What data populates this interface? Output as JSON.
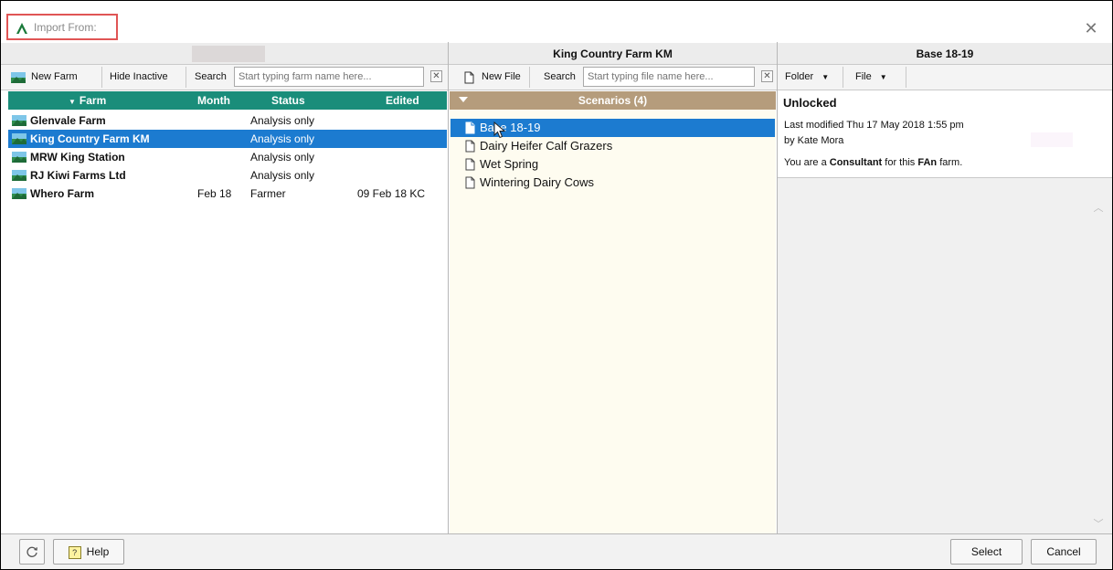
{
  "window": {
    "title": "Import From:"
  },
  "farm_panel": {
    "toolbar": {
      "new_farm": "New Farm",
      "hide_inactive": "Hide Inactive",
      "search_label": "Search",
      "search_placeholder": "Start typing farm name here..."
    },
    "columns": {
      "farm": "Farm",
      "month": "Month",
      "status": "Status",
      "edited": "Edited"
    },
    "rows": [
      {
        "name": "Glenvale Farm",
        "month": "",
        "status": "Analysis only",
        "edited": "",
        "selected": false
      },
      {
        "name": "King Country Farm KM",
        "month": "",
        "status": "Analysis only",
        "edited": "",
        "selected": true
      },
      {
        "name": "MRW King Station",
        "month": "",
        "status": "Analysis only",
        "edited": "",
        "selected": false
      },
      {
        "name": "RJ Kiwi Farms Ltd",
        "month": "",
        "status": "Analysis only",
        "edited": "",
        "selected": false
      },
      {
        "name": "Whero Farm",
        "month": "Feb 18",
        "status": "Farmer",
        "edited": "09 Feb 18 KC",
        "selected": false
      }
    ]
  },
  "file_panel": {
    "heading": "King Country Farm KM",
    "toolbar": {
      "new_file": "New File",
      "search_label": "Search",
      "search_placeholder": "Start typing file name here..."
    },
    "scenarios_title": "Scenarios (4)",
    "scenarios": [
      {
        "label": "Base 18-19",
        "selected": true
      },
      {
        "label": "Dairy Heifer Calf Grazers",
        "selected": false
      },
      {
        "label": "Wet Spring",
        "selected": false
      },
      {
        "label": "Wintering Dairy Cows",
        "selected": false
      }
    ]
  },
  "details_panel": {
    "heading": "Base 18-19",
    "toolbar": {
      "folder": "Folder",
      "file": "File"
    },
    "lock_status": "Unlocked",
    "last_modified": "Last modified Thu 17 May 2018 1:55 pm",
    "modified_by": "by Kate Mora",
    "role_prefix": "You are a",
    "role": "Consultant",
    "role_mid": "for this",
    "product": "FAn",
    "role_suffix": "farm."
  },
  "footer": {
    "help": "Help",
    "select": "Select",
    "cancel": "Cancel"
  },
  "colors": {
    "farm_header": "#1a8d7a",
    "selection": "#1c7bd0",
    "scenario_header": "#b59c7c",
    "scenario_bg": "#fefcf0",
    "title_highlight": "#e05555"
  }
}
